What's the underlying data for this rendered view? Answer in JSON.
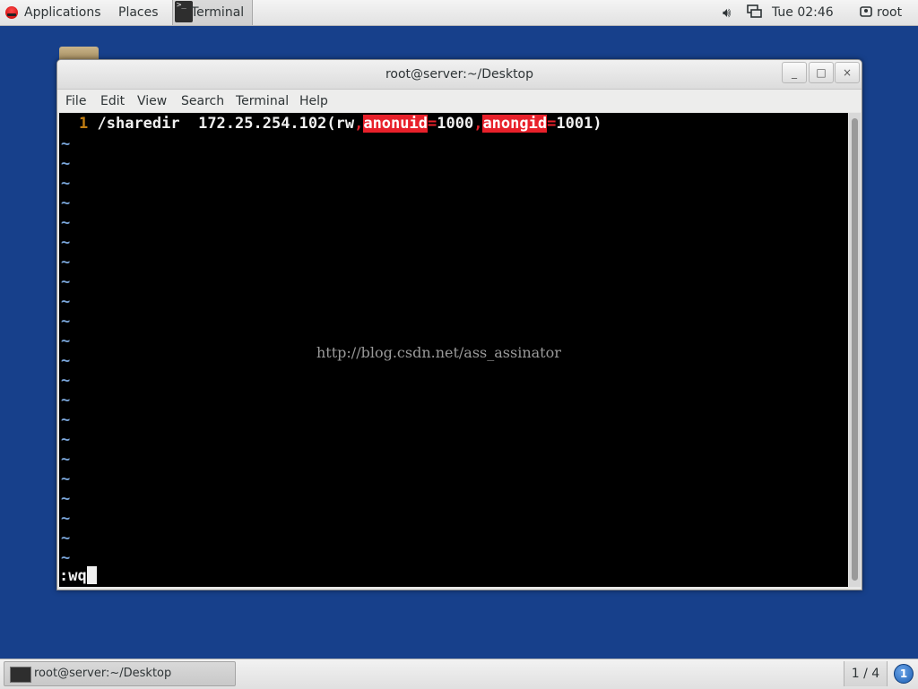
{
  "top_panel": {
    "applications": "Applications",
    "places": "Places",
    "active_app": "Terminal",
    "clock": "Tue 02:46",
    "user": "root"
  },
  "window": {
    "title": "root@server:~/Desktop",
    "controls": {
      "minimize": "_",
      "maximize": "□",
      "close": "×"
    },
    "menu": [
      "File",
      "Edit",
      "View",
      "Search",
      "Terminal",
      "Help"
    ]
  },
  "editor": {
    "line_number": "1",
    "line": {
      "path": "/sharedir  172.25.254.102(rw",
      "comma1": ",",
      "opt1": "anonuid",
      "eq1": "=",
      "val1": "1000",
      "comma2": ",",
      "opt2": "anongid",
      "eq2": "=",
      "val2": "1001)"
    },
    "tilde": "~",
    "command": ":wq",
    "watermark": "http://blog.csdn.net/ass_assinator"
  },
  "bottom_panel": {
    "task_label": "root@server:~/Desktop",
    "workspace": "1 / 4",
    "notifications": "1"
  },
  "colors": {
    "desktop": "#17408b",
    "highlight": "#e8202a",
    "line_number": "#c17d11",
    "tilde": "#7aa6da"
  }
}
